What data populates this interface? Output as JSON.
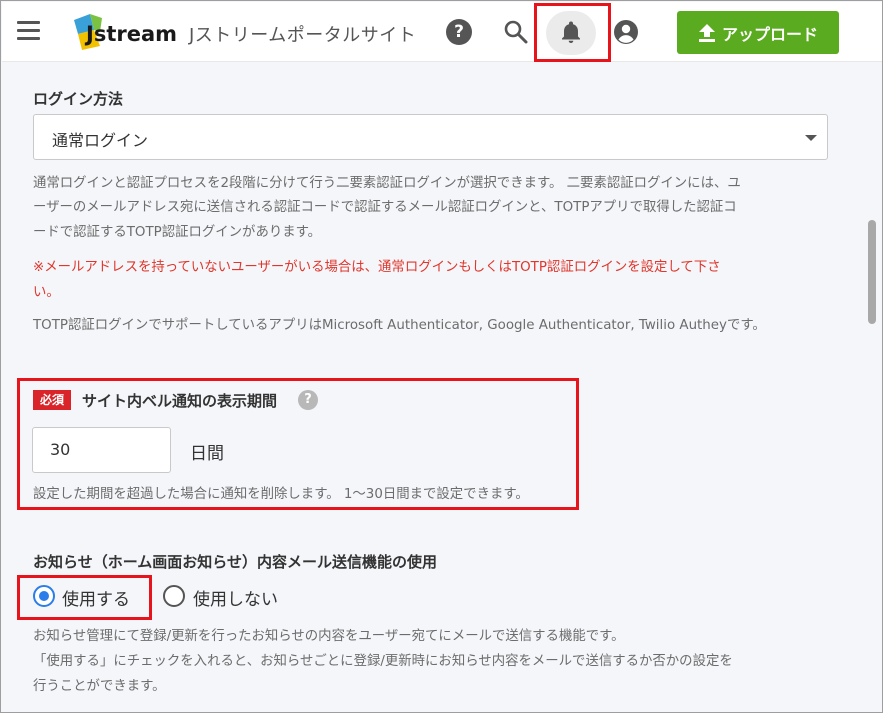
{
  "header": {
    "logo_text": "Jstream",
    "site_title": "Jストリームポータルサイト",
    "help_icon": "question-circle-icon",
    "search_icon": "search-icon",
    "bell_icon": "bell-icon",
    "account_icon": "account-circle-icon",
    "upload_label": "アップロード",
    "upload_color": "#5aab1f"
  },
  "login": {
    "label": "ログイン方法",
    "selected": "通常ログイン",
    "help_line1": "通常ログインと認証プロセスを2段階に分けて行う二要素認証ログインが選択できます。 二要素認証ログインには、ユ",
    "help_line2": "ーザーのメールアドレス宛に送信される認証コードで認証するメール認証ログインと、TOTPアプリで取得した認証コ",
    "help_line3": "ードで認証するTOTP認証ログインがあります。",
    "warn_line1": "※メールアドレスを持っていないユーザーがいる場合は、通常ログインもしくはTOTP認証ログインを設定して下さ",
    "warn_line2": "い。",
    "totp_note": "TOTP認証ログインでサポートしているアプリはMicrosoft Authenticator, Google Authenticator, Twilio Autheyです。"
  },
  "bell_period": {
    "required_badge": "必須",
    "label": "サイト内ベル通知の表示期間",
    "value": "30",
    "unit": "日間",
    "help": "設定した期間を超過した場合に通知を削除します。 1〜30日間まで設定できます。"
  },
  "mail_notice": {
    "label": "お知らせ（ホーム画面お知らせ）内容メール送信機能の使用",
    "option_use": "使用する",
    "option_nouse": "使用しない",
    "selected": "使用する",
    "help_line1": "お知らせ管理にて登録/更新を行ったお知らせの内容をユーザー宛てにメールで送信する機能です。",
    "help_line2": "「使用する」にチェックを入れると、お知らせごとに登録/更新時にお知らせ内容をメールで送信するか否かの設定を",
    "help_line3": "行うことができます。"
  },
  "colors": {
    "highlight": "#e8141b",
    "warning_text": "#e0362c",
    "required_badge": "#d9252a",
    "radio_selected": "#2b7de9"
  }
}
